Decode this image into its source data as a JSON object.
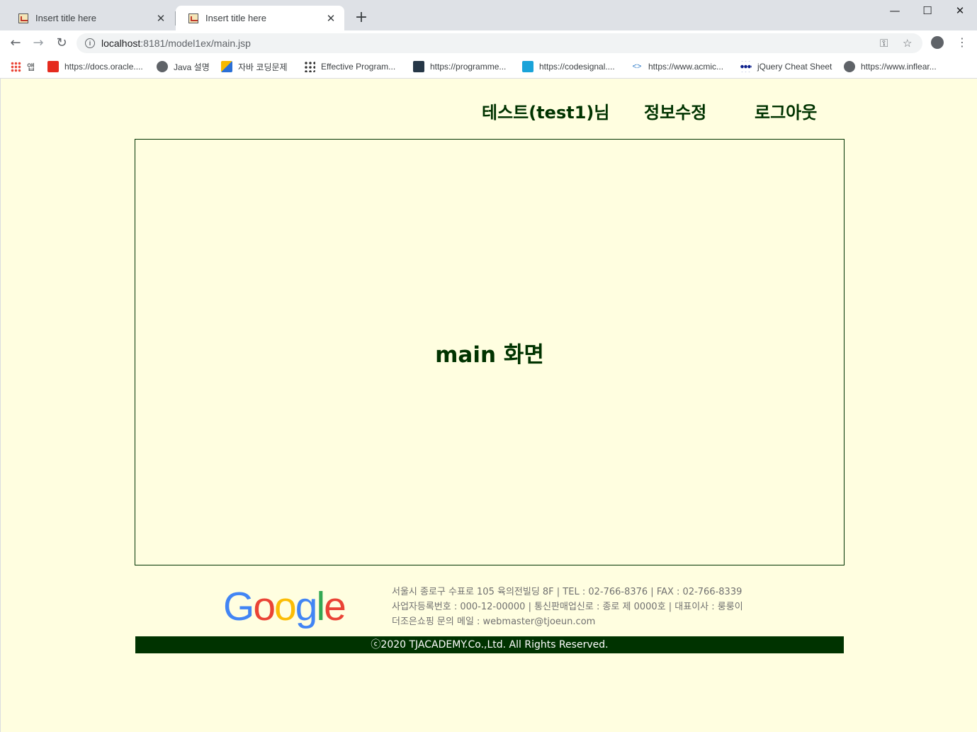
{
  "tabs": [
    {
      "title": "Insert title here",
      "close": "✕"
    },
    {
      "title": "Insert title here",
      "close": "✕"
    }
  ],
  "new_tab": "+",
  "window_controls": {
    "minimize": "—",
    "maximize": "☐",
    "close": "✕"
  },
  "toolbar": {
    "back": "←",
    "forward": "→",
    "reload": "↻",
    "url_host": "localhost",
    "url_rest": ":8181/model1ex/main.jsp",
    "key_icon": "⚿",
    "star_icon": "☆",
    "menu": "⋮"
  },
  "bookmarks": [
    {
      "label": "앱",
      "icon": "apps-icon",
      "color": "#4285f4"
    },
    {
      "label": "https://docs.oracle....",
      "icon": "oracle-icon",
      "color": "#e52b1e"
    },
    {
      "label": "Java 설명",
      "icon": "globe-icon",
      "color": "#5f6368"
    },
    {
      "label": "자바 코딩문제",
      "icon": "folder-icon",
      "color": "#f6b900"
    },
    {
      "label": "Effective Program...",
      "icon": "dots-icon",
      "color": "#333333"
    },
    {
      "label": "https://programme...",
      "icon": "programmers-icon",
      "color": "#263747"
    },
    {
      "label": "https://codesignal....",
      "icon": "codesignal-icon",
      "color": "#1aa3d9"
    },
    {
      "label": "https://www.acmic...",
      "icon": "code-icon",
      "color": "#2b79c7"
    },
    {
      "label": "jQuery Cheat Sheet",
      "icon": "jquery-icon",
      "color": "#0b1e8c"
    },
    {
      "label": "https://www.inflear...",
      "icon": "globe-icon",
      "color": "#5f6368"
    }
  ],
  "nav": {
    "user": "테스트(test1)님",
    "edit": "정보수정",
    "logout": "로그아웃"
  },
  "main": {
    "title": "main 화면"
  },
  "footer": {
    "logo_letters": [
      {
        "ch": "G",
        "color": "#4285f4"
      },
      {
        "ch": "o",
        "color": "#ea4335"
      },
      {
        "ch": "o",
        "color": "#fbbc05"
      },
      {
        "ch": "g",
        "color": "#4285f4"
      },
      {
        "ch": "l",
        "color": "#34a853"
      },
      {
        "ch": "e",
        "color": "#ea4335"
      }
    ],
    "address": "서울시 종로구 수표로 105 육의전빌딩 8F | TEL : 02-766-8376 | FAX : 02-766-8339",
    "business": "사업자등록번호 : 000-12-00000 | 통신판매업신로 : 종로 제 0000호 | 대표이사 : 룽룽이",
    "email": "더조은쇼핑 문의 메일 : webmaster@tjoeun.com",
    "copyright": "ⓒ2020 TJACADEMY.Co.,Ltd. All Rights Reserved."
  },
  "colors": {
    "page_bg": "#fffee0",
    "accent": "#003300"
  }
}
